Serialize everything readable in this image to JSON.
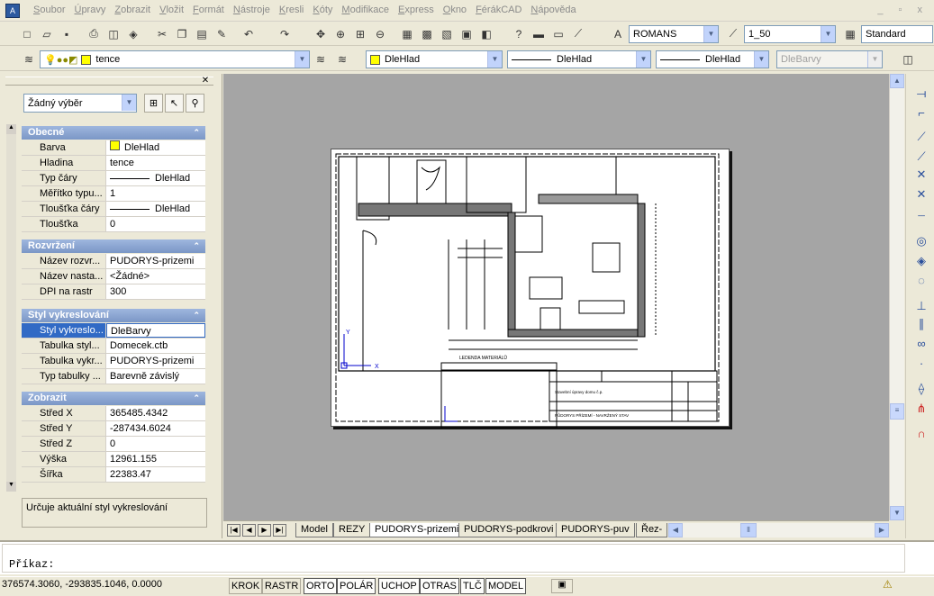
{
  "menu": [
    "Soubor",
    "Úpravy",
    "Zobrazit",
    "Vložit",
    "Formát",
    "Nástroje",
    "Kresli",
    "Kóty",
    "Modifikace",
    "Express",
    "Okno",
    "FérákCAD",
    "Nápověda"
  ],
  "window_controls": "_ ▫ x",
  "toolbar1": {
    "text_style": "ROMANS",
    "dim_scale": "1_50",
    "table_style": "Standard"
  },
  "toolbar2": {
    "layer": "tence",
    "color": "DleHlad",
    "linetype": "DleHlad",
    "lineweight": "DleHlad",
    "plotstyle": "DleBarvy"
  },
  "palette": {
    "selection": "Žádný výběr",
    "sections": [
      {
        "title": "Obecné",
        "rows": [
          [
            "Barva",
            "DleHlad"
          ],
          [
            "Hladina",
            "tence"
          ],
          [
            "Typ čáry",
            "DleHlad"
          ],
          [
            "Měřítko typu...",
            "1"
          ],
          [
            "Tloušťka čáry",
            "DleHlad"
          ],
          [
            "Tloušťka",
            "0"
          ]
        ]
      },
      {
        "title": "Rozvržení",
        "rows": [
          [
            "Název rozvr...",
            "PUDORYS-prizemi"
          ],
          [
            "Název nasta...",
            "<Žádné>"
          ],
          [
            "DPI na rastr",
            "300"
          ]
        ]
      },
      {
        "title": "Styl vykreslování",
        "rows": [
          [
            "Styl vykreslo...",
            "DleBarvy"
          ],
          [
            "Tabulka styl...",
            "Domecek.ctb"
          ],
          [
            "Tabulka vykr...",
            "PUDORYS-prizemi"
          ],
          [
            "Typ tabulky ...",
            "Barevně závislý"
          ]
        ]
      },
      {
        "title": "Zobrazit",
        "rows": [
          [
            "Střed X",
            "365485.4342"
          ],
          [
            "Střed Y",
            "-287434.6024"
          ],
          [
            "Střed Z",
            "0"
          ],
          [
            "Výška",
            "12961.155"
          ],
          [
            "Šířka",
            "22383.47"
          ]
        ]
      }
    ],
    "description": "Určuje aktuální styl vykreslování"
  },
  "drawing": {
    "legend": "LEDENDA MATERIÁLŮ",
    "title_line1": "Stavební úpravy domu č.p.",
    "title_line2": "PŮDORYS PŘÍZEMÍ - NAVRŽENÝ STAV",
    "axis_y": "Y",
    "axis_x": "X"
  },
  "tabs": [
    "Model",
    "REZY",
    "PUDORYS-prizemi",
    "PUDORYS-podkrovi",
    "PUDORYS-puv",
    "Řez-"
  ],
  "command": {
    "prompt": "Příkaz:"
  },
  "status": {
    "coords": "376574.3060, -293835.1046, 0.0000",
    "buttons": [
      "KROK",
      "RASTR",
      "ORTO",
      "POLÁR",
      "UCHOP",
      "OTRAS",
      "TLČ",
      "MODEL"
    ]
  }
}
